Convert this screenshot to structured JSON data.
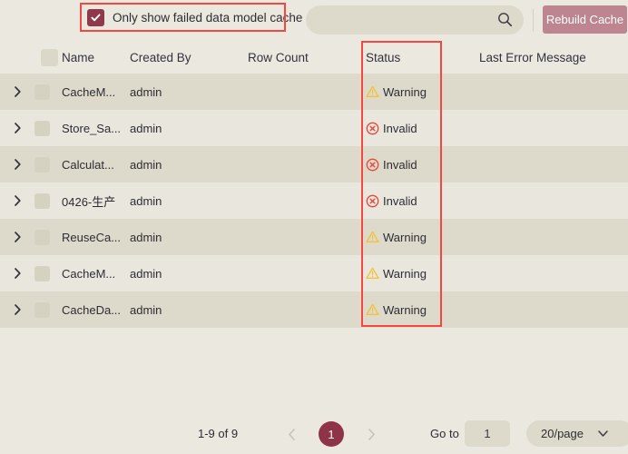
{
  "toolbar": {
    "filter_checkbox": {
      "label": "Only show failed data model cache",
      "checked": true,
      "icon": "check-icon"
    },
    "search": {
      "value": "",
      "placeholder": "",
      "icon": "search-icon"
    },
    "rebuild_button": {
      "label": "Rebuild Cache"
    }
  },
  "table": {
    "columns": [
      {
        "key": "expander",
        "label": ""
      },
      {
        "key": "select",
        "label": ""
      },
      {
        "key": "name",
        "label": "Name"
      },
      {
        "key": "created_by",
        "label": "Created By"
      },
      {
        "key": "row_count",
        "label": "Row Count"
      },
      {
        "key": "status",
        "label": "Status"
      },
      {
        "key": "last_error",
        "label": "Last Error Message"
      }
    ],
    "rows": [
      {
        "name": "CacheM...",
        "created_by": "admin",
        "row_count": "",
        "status": "Warning",
        "status_type": "warning",
        "last_error": ""
      },
      {
        "name": "Store_Sa...",
        "created_by": "admin",
        "row_count": "",
        "status": "Invalid",
        "status_type": "invalid",
        "last_error": ""
      },
      {
        "name": "Calculat...",
        "created_by": "admin",
        "row_count": "",
        "status": "Invalid",
        "status_type": "invalid",
        "last_error": ""
      },
      {
        "name": "0426-生产",
        "created_by": "admin",
        "row_count": "",
        "status": "Invalid",
        "status_type": "invalid",
        "last_error": ""
      },
      {
        "name": "ReuseCa...",
        "created_by": "admin",
        "row_count": "",
        "status": "Warning",
        "status_type": "warning",
        "last_error": ""
      },
      {
        "name": "CacheM...",
        "created_by": "admin",
        "row_count": "",
        "status": "Warning",
        "status_type": "warning",
        "last_error": ""
      },
      {
        "name": "CacheDa...",
        "created_by": "admin",
        "row_count": "",
        "status": "Warning",
        "status_type": "warning",
        "last_error": ""
      }
    ]
  },
  "pagination": {
    "total_text": "1-9 of 9",
    "prev_icon": "chevron-left-icon",
    "next_icon": "chevron-right-icon",
    "current_page": "1",
    "goto_label": "Go to",
    "goto_value": "1",
    "page_size": "20/page",
    "page_size_icon": "chevron-down-icon"
  },
  "annotations": [
    {
      "name": "checkbox-highlight",
      "color": "#f4473f"
    },
    {
      "name": "status-column-highlight",
      "color": "#f4473f"
    }
  ],
  "colors": {
    "accent_maroon": "#8f3349",
    "button_rose": "#bd8590",
    "warning": "#f2c230",
    "invalid": "#e8453c",
    "annotation_red": "#f4473f",
    "page_bg": "#ebe8e0",
    "row_odd": "#ddd9cb"
  }
}
